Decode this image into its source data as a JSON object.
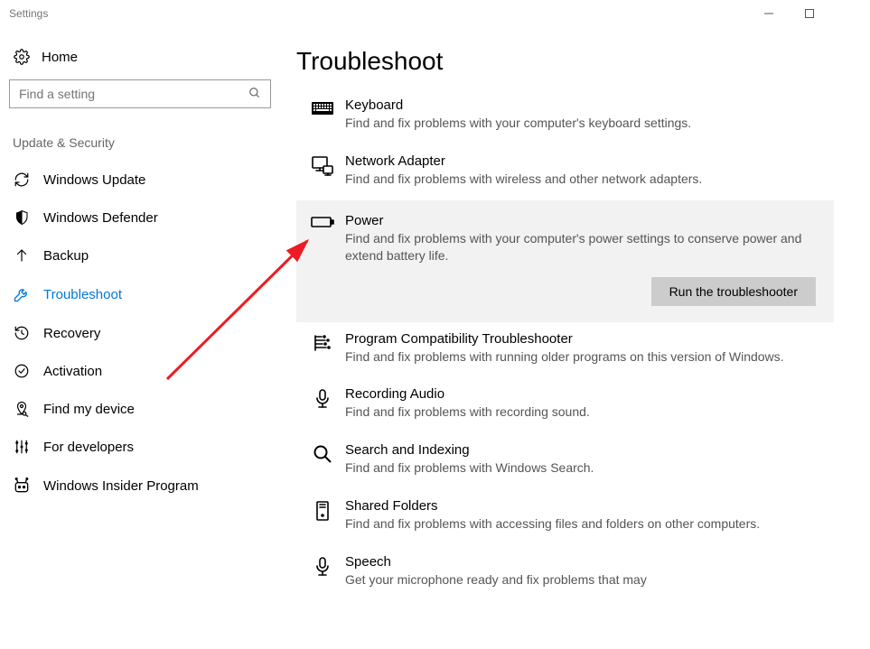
{
  "window": {
    "title": "Settings"
  },
  "sidebar": {
    "home_label": "Home",
    "search_placeholder": "Find a setting",
    "section_header": "Update & Security",
    "items": [
      {
        "label": "Windows Update",
        "icon": "refresh"
      },
      {
        "label": "Windows Defender",
        "icon": "shield"
      },
      {
        "label": "Backup",
        "icon": "backup"
      },
      {
        "label": "Troubleshoot",
        "icon": "wrench",
        "active": true
      },
      {
        "label": "Recovery",
        "icon": "recovery"
      },
      {
        "label": "Activation",
        "icon": "check-circle"
      },
      {
        "label": "Find my device",
        "icon": "location"
      },
      {
        "label": "For developers",
        "icon": "developers"
      },
      {
        "label": "Windows Insider Program",
        "icon": "insider"
      }
    ]
  },
  "main": {
    "title": "Troubleshoot",
    "run_label": "Run the troubleshooter",
    "items": [
      {
        "title": "Keyboard",
        "desc": "Find and fix problems with your computer's keyboard settings.",
        "icon": "keyboard"
      },
      {
        "title": "Network Adapter",
        "desc": "Find and fix problems with wireless and other network adapters.",
        "icon": "network"
      },
      {
        "title": "Power",
        "desc": "Find and fix problems with your computer's power settings to conserve power and extend battery life.",
        "icon": "battery",
        "selected": true
      },
      {
        "title": "Program Compatibility Troubleshooter",
        "desc": "Find and fix problems with running older programs on this version of Windows.",
        "icon": "compatibility"
      },
      {
        "title": "Recording Audio",
        "desc": "Find and fix problems with recording sound.",
        "icon": "microphone"
      },
      {
        "title": "Search and Indexing",
        "desc": "Find and fix problems with Windows Search.",
        "icon": "search"
      },
      {
        "title": "Shared Folders",
        "desc": "Find and fix problems with accessing files and folders on other computers.",
        "icon": "tower"
      },
      {
        "title": "Speech",
        "desc": "Get your microphone ready and fix problems that may",
        "icon": "microphone"
      }
    ]
  }
}
